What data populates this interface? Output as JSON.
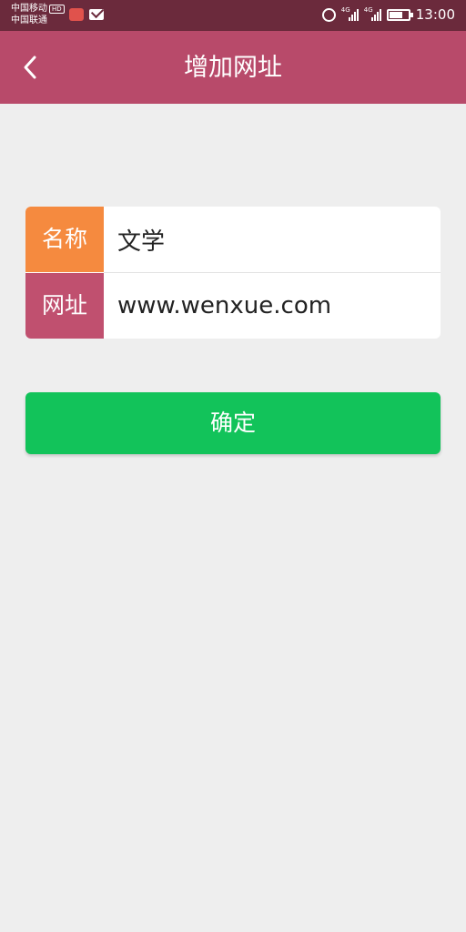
{
  "status_bar": {
    "carrier_1": "中国移动",
    "carrier_1_badge": "HD",
    "carrier_2": "中国联通",
    "lte_1": "4G",
    "lte_2": "4G",
    "time": "13:00",
    "icons": [
      "weibo-icon",
      "mail-icon",
      "alarm-icon",
      "signal-icon",
      "signal-icon",
      "battery-icon"
    ]
  },
  "header": {
    "title": "增加网址",
    "back_icon": "chevron-left-icon",
    "background": "#b84a6a"
  },
  "form": {
    "name_label": "名称",
    "name_value": "文学",
    "url_label": "网址",
    "url_value": "www.wenxue.com",
    "name_label_color": "#f58a3f",
    "url_label_color": "#c0506f"
  },
  "confirm_button": {
    "label": "确定",
    "color": "#12c35a"
  }
}
